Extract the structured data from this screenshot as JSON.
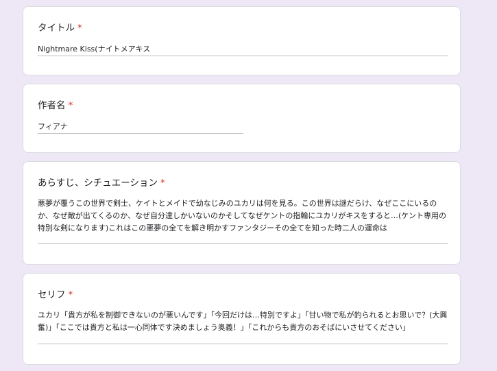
{
  "required_mark": "*",
  "form": {
    "title_question": {
      "label": "タイトル",
      "answer": "Nightmare Kiss(ナイトメアキス"
    },
    "author_question": {
      "label": "作者名",
      "answer": "フィアナ"
    },
    "synopsis_question": {
      "label": "あらすじ、シチュエーション",
      "answer": "悪夢が覆うこの世界で剣士、ケイトとメイドで幼なじみのユカリは何を見る。この世界は謎だらけ、なぜここにいるのか、なぜ敵が出てくるのか、なぜ自分達しかいないのかそしてなぜケントの指輪にユカリがキスをすると…(ケント専用の特別な剣になります)これはこの悪夢の全てを解き明かすファンタジーその全てを知った時二人の運命は"
    },
    "lines_question": {
      "label": "セリフ",
      "answer": "ユカリ「貴方が私を制御できないのが悪いんです」「今回だけは…特別ですよ」「甘い物で私が釣られるとお思いで？(大興奮)」「ここでは貴方と私は一心同体です決めましょう奥義！」「これからも貴方のおそばにいさせてください」"
    }
  },
  "colors": {
    "background": "#ede7f6",
    "card": "#ffffff",
    "required": "#d93025",
    "text": "#202124"
  }
}
